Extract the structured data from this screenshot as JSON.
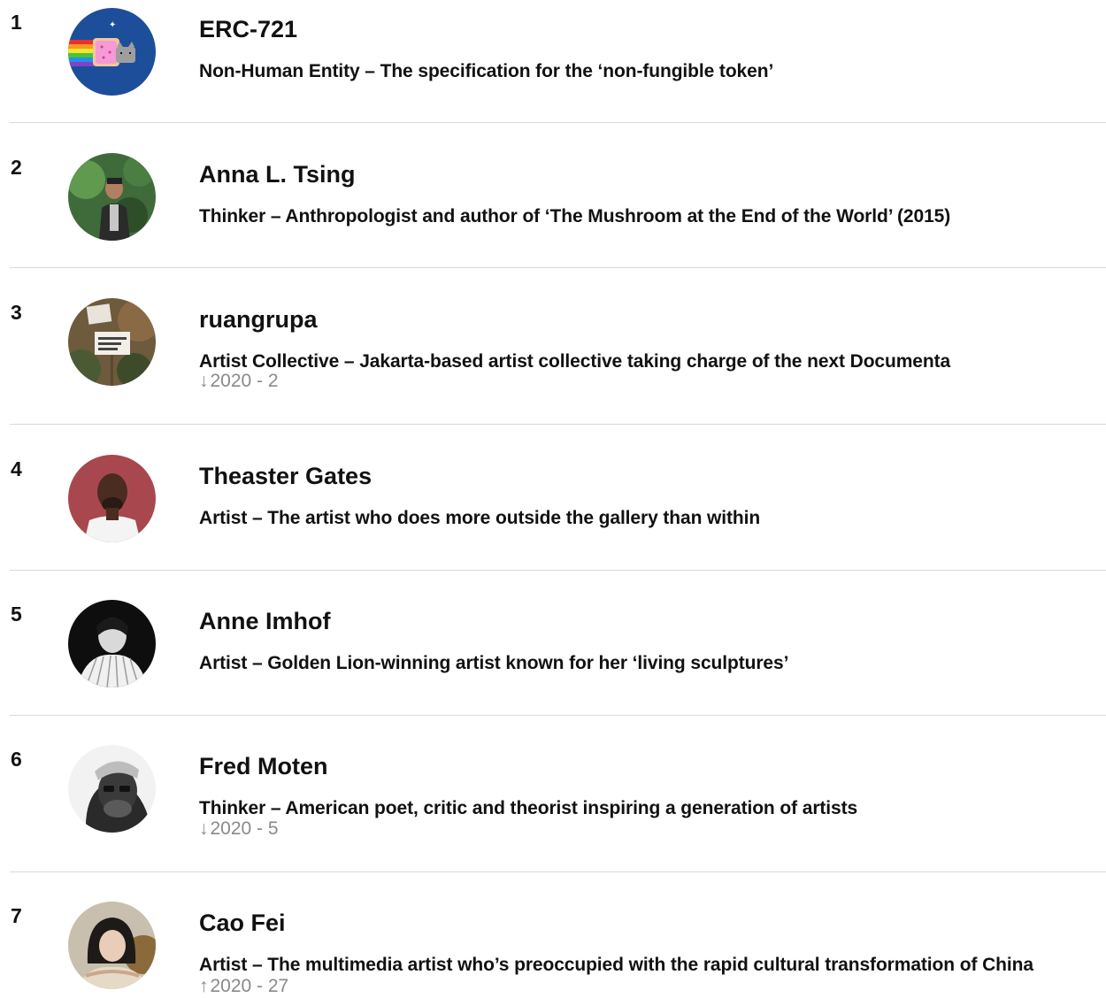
{
  "entries": [
    {
      "rank": "1",
      "name": "ERC-721",
      "description": "Non-Human Entity – The specification for the ‘non-fungible token’",
      "previous": null,
      "avatar_icon": "nyan-cat-avatar"
    },
    {
      "rank": "2",
      "name": "Anna L. Tsing",
      "description": "Thinker – Anthropologist and author of ‘The Mushroom at the End of the World’ (2015)",
      "previous": null,
      "avatar_icon": "portrait-avatar"
    },
    {
      "rank": "3",
      "name": "ruangrupa",
      "description": "Artist Collective – Jakarta-based artist collective taking charge of the next Documenta",
      "previous": {
        "arrow": "↓",
        "text": "2020 - 2"
      },
      "avatar_icon": "collective-photo-avatar"
    },
    {
      "rank": "4",
      "name": "Theaster Gates",
      "description": "Artist – The artist who does more outside the gallery than within",
      "previous": null,
      "avatar_icon": "portrait-avatar"
    },
    {
      "rank": "5",
      "name": "Anne Imhof",
      "description": "Artist – Golden Lion-winning artist known for her ‘living sculptures’",
      "previous": null,
      "avatar_icon": "portrait-avatar"
    },
    {
      "rank": "6",
      "name": "Fred Moten",
      "description": "Thinker – American poet, critic and theorist inspiring a generation of artists",
      "previous": {
        "arrow": "↓",
        "text": "2020 - 5"
      },
      "avatar_icon": "portrait-avatar"
    },
    {
      "rank": "7",
      "name": "Cao Fei",
      "description": "Artist – The multimedia artist who’s preoccupied with the rapid cultural transformation of China",
      "previous": {
        "arrow": "↑",
        "text": "2020 - 27"
      },
      "avatar_icon": "portrait-avatar"
    }
  ],
  "colors": {
    "text": "#111111",
    "muted": "#8a8a8a",
    "divider": "#d9d9d9"
  }
}
